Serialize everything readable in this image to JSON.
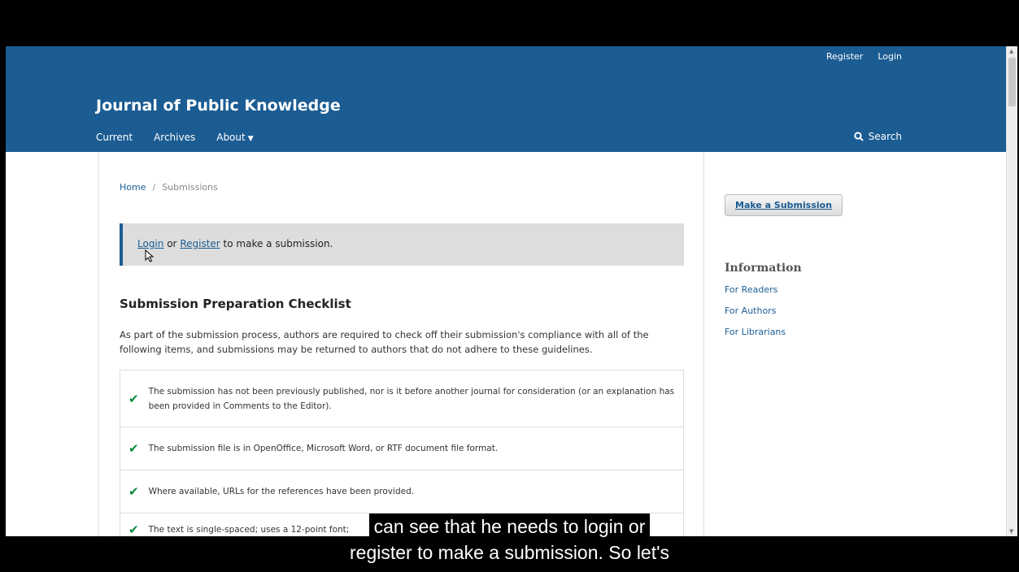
{
  "header": {
    "user_nav": {
      "register": "Register",
      "login": "Login"
    },
    "site_title": "Journal of Public Knowledge",
    "nav": {
      "current": "Current",
      "archives": "Archives",
      "about": "About"
    },
    "search_label": "Search"
  },
  "breadcrumb": {
    "home": "Home",
    "separator": "/",
    "current": "Submissions"
  },
  "notice": {
    "login": "Login",
    "or": "or",
    "register": "Register",
    "rest": "to make a submission."
  },
  "checklist": {
    "title": "Submission Preparation Checklist",
    "intro": "As part of the submission process, authors are required to check off their submission's compliance with all of the following items, and submissions may be returned to authors that do not adhere to these guidelines.",
    "items": [
      "The submission has not been previously published, nor is it before another journal for consideration (or an explanation has been provided in Comments to the Editor).",
      "The submission file is in OpenOffice, Microsoft Word, or RTF document file format.",
      "Where available, URLs for the references have been provided.",
      "The text is single-spaced; uses a 12-point font;"
    ]
  },
  "sidebar": {
    "submit_button": "Make a Submission",
    "info_title": "Information",
    "links": [
      "For Readers",
      "For Authors",
      "For Librarians"
    ]
  },
  "caption": {
    "line1": "can see that he needs to login or",
    "line2": "register to make a submission. So let's"
  },
  "colors": {
    "header_bg": "#1b5c93",
    "link": "#1b5c93",
    "check": "#0a8a3a"
  }
}
